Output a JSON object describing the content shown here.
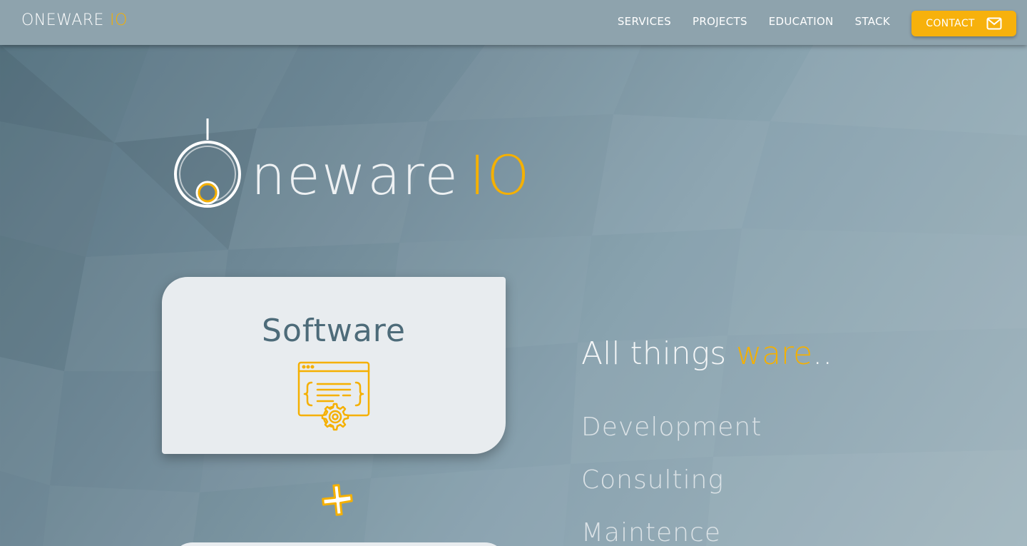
{
  "navbar": {
    "brand_main": "ONEWARE",
    "brand_accent": "IO",
    "links": [
      "SERVICES",
      "PROJECTS",
      "EDUCATION",
      "STACK"
    ],
    "contact_label": "CONTACT",
    "contact_icon": "mail-icon"
  },
  "hero": {
    "logo_word": "neware",
    "logo_accent": "IO"
  },
  "software_card": {
    "title": "Software",
    "icon": "code-window-gear-icon"
  },
  "plus_icon": "plus-icon",
  "tagline": {
    "prefix": "All things ",
    "accent": "ware",
    "suffix": ".."
  },
  "services": [
    "Development",
    "Consulting",
    "Maintence"
  ],
  "colors": {
    "accent": "#f5b000",
    "navbar_bg": "#8ea3ad",
    "card_bg": "#e8ecef",
    "card_title": "#4d6b79"
  }
}
